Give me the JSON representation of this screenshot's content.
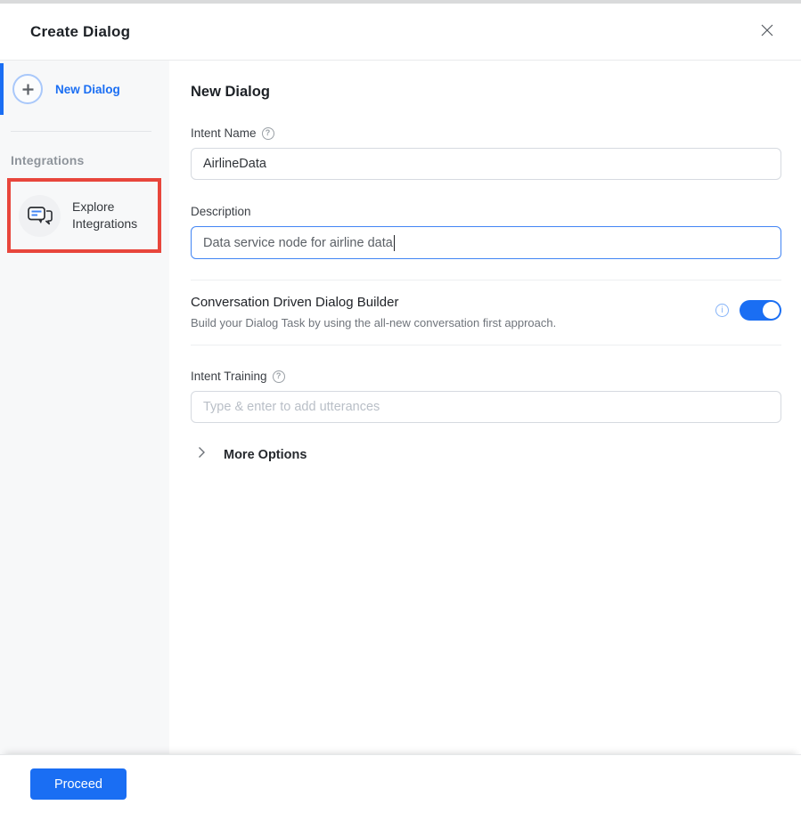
{
  "dialog": {
    "title": "Create Dialog"
  },
  "sidebar": {
    "new_dialog_label": "New Dialog",
    "integrations_section_label": "Integrations",
    "explore_integrations_label": "Explore Integrations"
  },
  "form": {
    "heading": "New Dialog",
    "intent_name_label": "Intent Name",
    "intent_name_value": "AirlineData",
    "description_label": "Description",
    "description_value": "Data service node for airline data",
    "cdd_title": "Conversation Driven Dialog Builder",
    "cdd_subtitle": "Build your Dialog Task by using the all-new conversation first approach.",
    "cdd_toggle_state": "on",
    "intent_training_label": "Intent Training",
    "intent_training_placeholder": "Type & enter to add utterances",
    "more_options_label": "More Options"
  },
  "footer": {
    "proceed_label": "Proceed"
  },
  "icons": {
    "help_glyph": "?",
    "info_glyph": "i"
  },
  "colors": {
    "accent_blue": "#1a6ef3",
    "focus_border_blue": "#4285f4",
    "annotation_red": "#e8463c",
    "sidebar_bg": "#f7f8f9"
  }
}
